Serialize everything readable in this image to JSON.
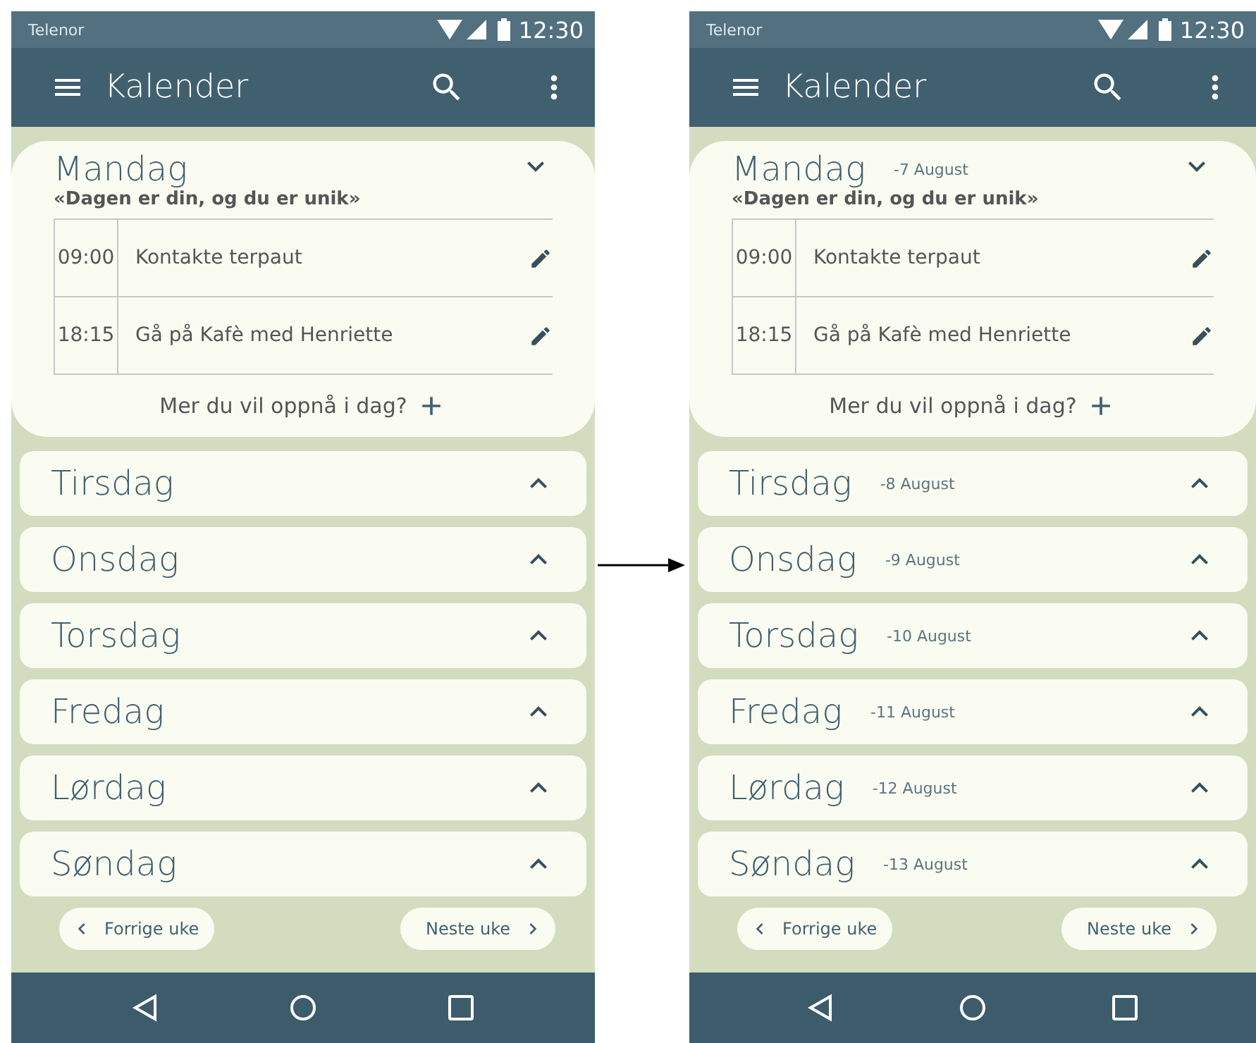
{
  "screens": [
    {
      "status_bar": {
        "carrier": "Telenor",
        "time": "12:30"
      },
      "app_bar": {
        "title": "Kalender"
      },
      "days": [
        {
          "name": "Mandag",
          "expanded": true,
          "quote": "«Dagen er din, og du er unik»",
          "events": [
            {
              "time": "09:00",
              "title": "Kontakte terpaut"
            },
            {
              "time": "18:15",
              "title": "Gå på Kafè med Henriette"
            }
          ],
          "add_label": "Mer du vil oppnå i dag?"
        },
        {
          "name": "Tirsdag",
          "expanded": false
        },
        {
          "name": "Onsdag",
          "expanded": false
        },
        {
          "name": "Torsdag",
          "expanded": false
        },
        {
          "name": "Fredag",
          "expanded": false
        },
        {
          "name": "Lørdag",
          "expanded": false
        },
        {
          "name": "Søndag",
          "expanded": false
        }
      ],
      "prev_button": "Forrige uke",
      "next_button": "Neste uke"
    },
    {
      "status_bar": {
        "carrier": "Telenor",
        "time": "12:30"
      },
      "app_bar": {
        "title": "Kalender"
      },
      "days": [
        {
          "name": "Mandag",
          "date": "-7 August",
          "expanded": true,
          "quote": "«Dagen er din, og du er unik»",
          "events": [
            {
              "time": "09:00",
              "title": "Kontakte terpaut"
            },
            {
              "time": "18:15",
              "title": "Gå på Kafè med Henriette"
            }
          ],
          "add_label": "Mer du vil oppnå i dag?"
        },
        {
          "name": "Tirsdag",
          "date": "-8 August",
          "expanded": false
        },
        {
          "name": "Onsdag",
          "date": "-9 August",
          "expanded": false
        },
        {
          "name": "Torsdag",
          "date": "-10 August",
          "expanded": false
        },
        {
          "name": "Fredag",
          "date": "-11 August",
          "expanded": false
        },
        {
          "name": "Lørdag",
          "date": "-12 August",
          "expanded": false
        },
        {
          "name": "Søndag",
          "date": "-13 August",
          "expanded": false
        }
      ],
      "prev_button": "Forrige uke",
      "next_button": "Neste uke"
    }
  ]
}
